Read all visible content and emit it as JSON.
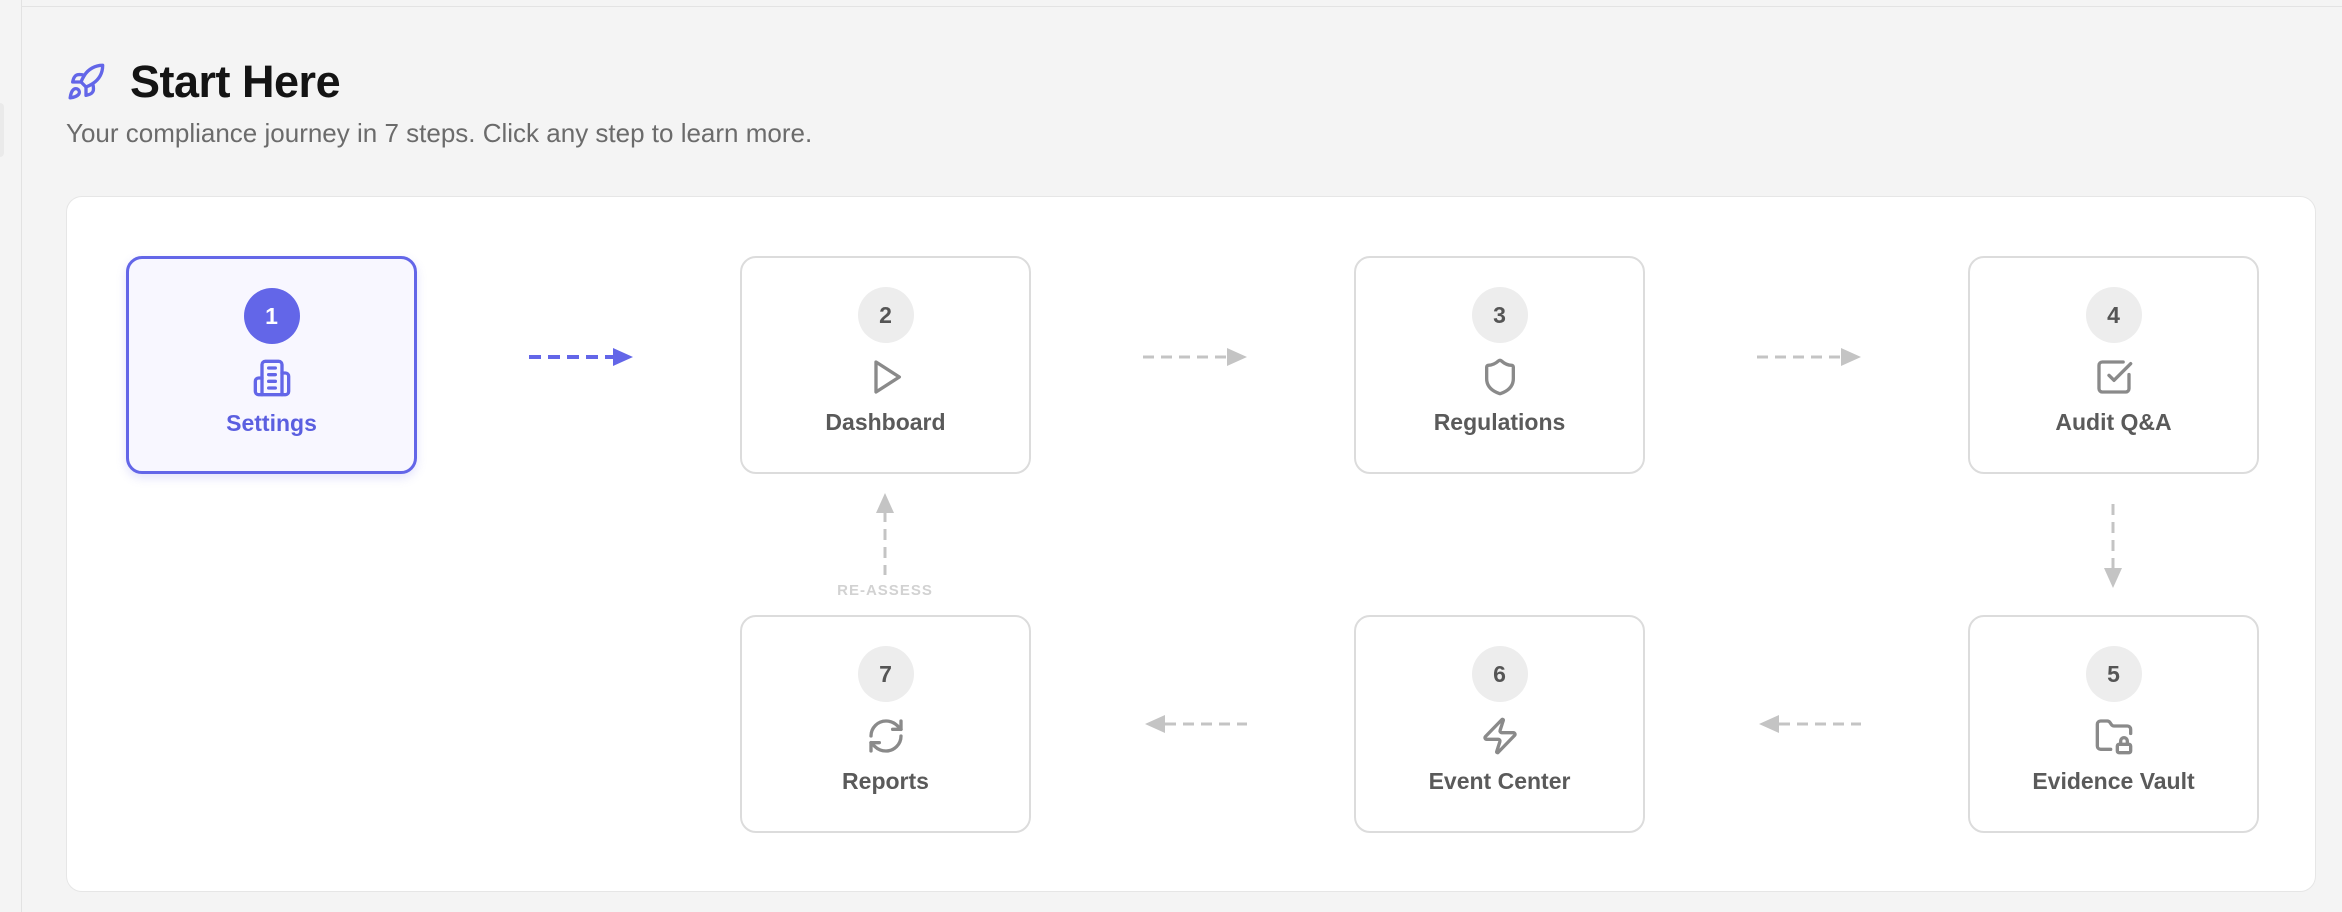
{
  "header": {
    "title": "Start Here",
    "subtitle": "Your compliance journey in 7 steps. Click any step to learn more.",
    "icon": "rocket-icon"
  },
  "colors": {
    "accent": "#6366e8",
    "inactive_border": "#dcdcdc",
    "connector": "#bdbdbd"
  },
  "steps": [
    {
      "number": "1",
      "label": "Settings",
      "icon": "building-icon",
      "active": true
    },
    {
      "number": "2",
      "label": "Dashboard",
      "icon": "play-icon",
      "active": false
    },
    {
      "number": "3",
      "label": "Regulations",
      "icon": "shield-icon",
      "active": false
    },
    {
      "number": "4",
      "label": "Audit Q&A",
      "icon": "checkbox-icon",
      "active": false
    },
    {
      "number": "5",
      "label": "Evidence Vault",
      "icon": "folder-lock-icon",
      "active": false
    },
    {
      "number": "6",
      "label": "Event Center",
      "icon": "lightning-icon",
      "active": false
    },
    {
      "number": "7",
      "label": "Reports",
      "icon": "refresh-icon",
      "active": false
    }
  ],
  "loop_label": "RE-ASSESS"
}
